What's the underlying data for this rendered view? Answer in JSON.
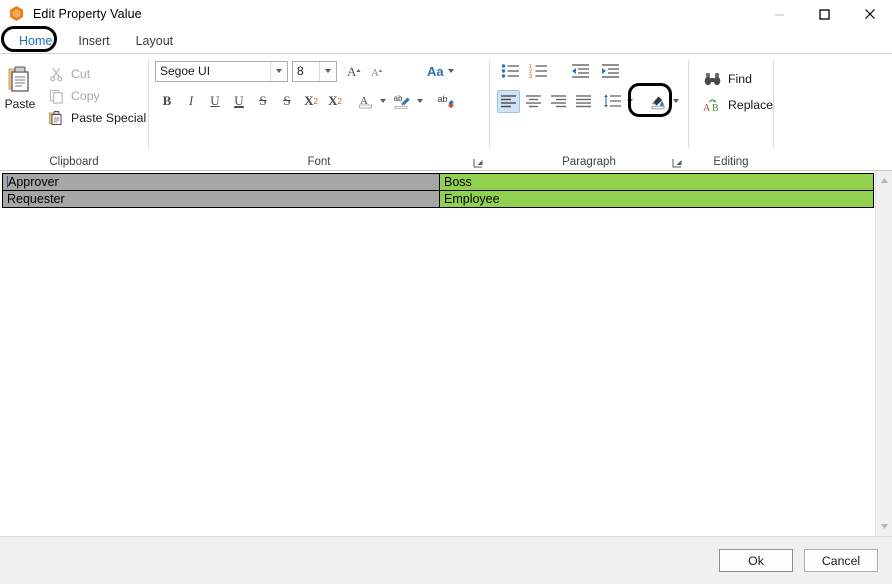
{
  "window": {
    "title": "Edit Property Value",
    "app_icon": "hexagon-orange-icon",
    "minimize_label": "Minimize",
    "maximize_label": "Maximize",
    "close_label": "Close"
  },
  "ribbon": {
    "tabs": [
      {
        "label": "Home",
        "active": true,
        "highlighted": true
      },
      {
        "label": "Insert",
        "active": false,
        "highlighted": false
      },
      {
        "label": "Layout",
        "active": false,
        "highlighted": false
      }
    ],
    "groups": {
      "clipboard": {
        "label": "Clipboard",
        "paste": {
          "label": "Paste",
          "enabled": true
        },
        "items": [
          {
            "label": "Cut",
            "icon": "scissors-icon",
            "enabled": false
          },
          {
            "label": "Copy",
            "icon": "copy-icon",
            "enabled": false
          },
          {
            "label": "Paste Special",
            "icon": "paste-special-icon",
            "enabled": true
          }
        ]
      },
      "font": {
        "label": "Font",
        "font_name": {
          "value": "Segoe UI",
          "placeholder": "Font"
        },
        "font_size": {
          "value": "8",
          "placeholder": "Size"
        },
        "grow_font": "Grow Font",
        "shrink_font": "Shrink Font",
        "change_case": "Aa",
        "bold": "B",
        "italic": "I",
        "underline": "U",
        "double_underline": "U",
        "strikethrough": "S",
        "double_strikethrough": "S",
        "superscript": "X",
        "superscript_sup": "2",
        "subscript": "X",
        "subscript_sub": "2",
        "font_color": "A",
        "text_highlight": "ab",
        "clear_formatting": "ab",
        "dialog_launcher": "Font dialog launcher"
      },
      "paragraph": {
        "label": "Paragraph",
        "bullets": "Bullets",
        "numbering": "Numbering",
        "decrease_indent": "Decrease Indent",
        "increase_indent": "Increase Indent",
        "align_left": "Align Left",
        "align_center": "Center",
        "align_right": "Align Right",
        "justify": "Justify",
        "line_spacing": "Line and Paragraph Spacing",
        "shading": "Shading",
        "shading_highlighted": true,
        "align_left_selected": true,
        "dialog_launcher": "Paragraph dialog launcher"
      },
      "editing": {
        "label": "Editing",
        "items": [
          {
            "label": "Find",
            "icon": "binoculars-icon"
          },
          {
            "label": "Replace",
            "icon": "replace-ab-icon"
          }
        ]
      }
    }
  },
  "document": {
    "caret_visible": true,
    "table": {
      "key_bg": "#A6A6A6",
      "value_bg": "#92D050",
      "rows": [
        {
          "key": "Approver",
          "value": "Boss"
        },
        {
          "key": "Requester",
          "value": "Employee"
        }
      ]
    },
    "scrollbar": {
      "up_arrow": "scroll-up-arrow-icon",
      "down_arrow": "scroll-down-arrow-icon"
    }
  },
  "footer": {
    "ok_label": "Ok",
    "cancel_label": "Cancel"
  },
  "colors": {
    "accent_blue": "#1F6FB8",
    "cell_gray": "#A6A6A6",
    "cell_green": "#92D050",
    "highlight_ring": "#000000",
    "selected_button": "#CFE3F7"
  }
}
